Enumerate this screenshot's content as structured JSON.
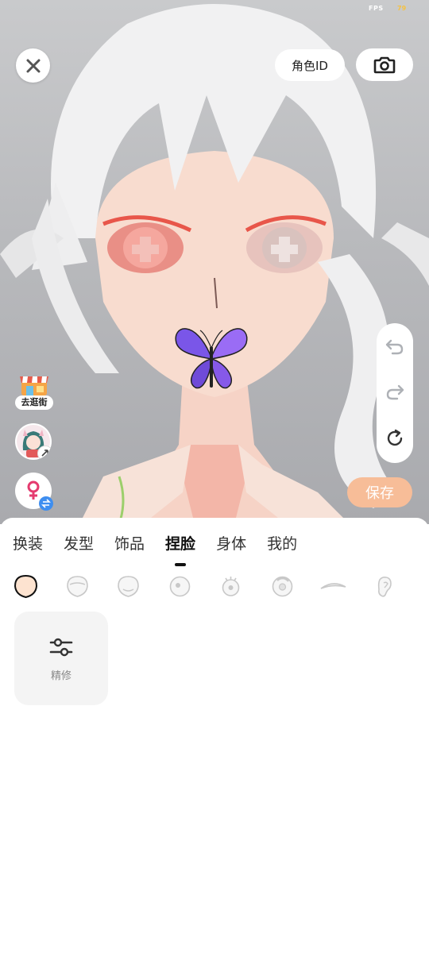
{
  "status": {
    "fps_label": "FPS",
    "fps_value": "79"
  },
  "header": {
    "role_id_label": "角色ID",
    "close_icon": "close-icon",
    "camera_icon": "camera-icon"
  },
  "side_tools": {
    "shop_label": "去逛街"
  },
  "history": {
    "undo_icon": "undo-icon",
    "redo_icon": "redo-icon",
    "reset_icon": "reset-icon"
  },
  "actions": {
    "save_label": "保存"
  },
  "tabs": [
    {
      "label": "换装"
    },
    {
      "label": "发型"
    },
    {
      "label": "饰品"
    },
    {
      "label": "捏脸",
      "active": true
    },
    {
      "label": "身体"
    },
    {
      "label": "我的"
    }
  ],
  "face_parts": [
    "face-shape-icon",
    "head-icon",
    "head-side-icon",
    "eye-icon",
    "eye-lashes-icon",
    "pupil-icon",
    "eyebrow-icon",
    "ear-icon"
  ],
  "refine": {
    "label": "精修",
    "icon": "sliders-icon"
  },
  "colors": {
    "accent": "#f7bd98",
    "active_tab": "#111111",
    "butterfly": "#8a5cf0"
  }
}
